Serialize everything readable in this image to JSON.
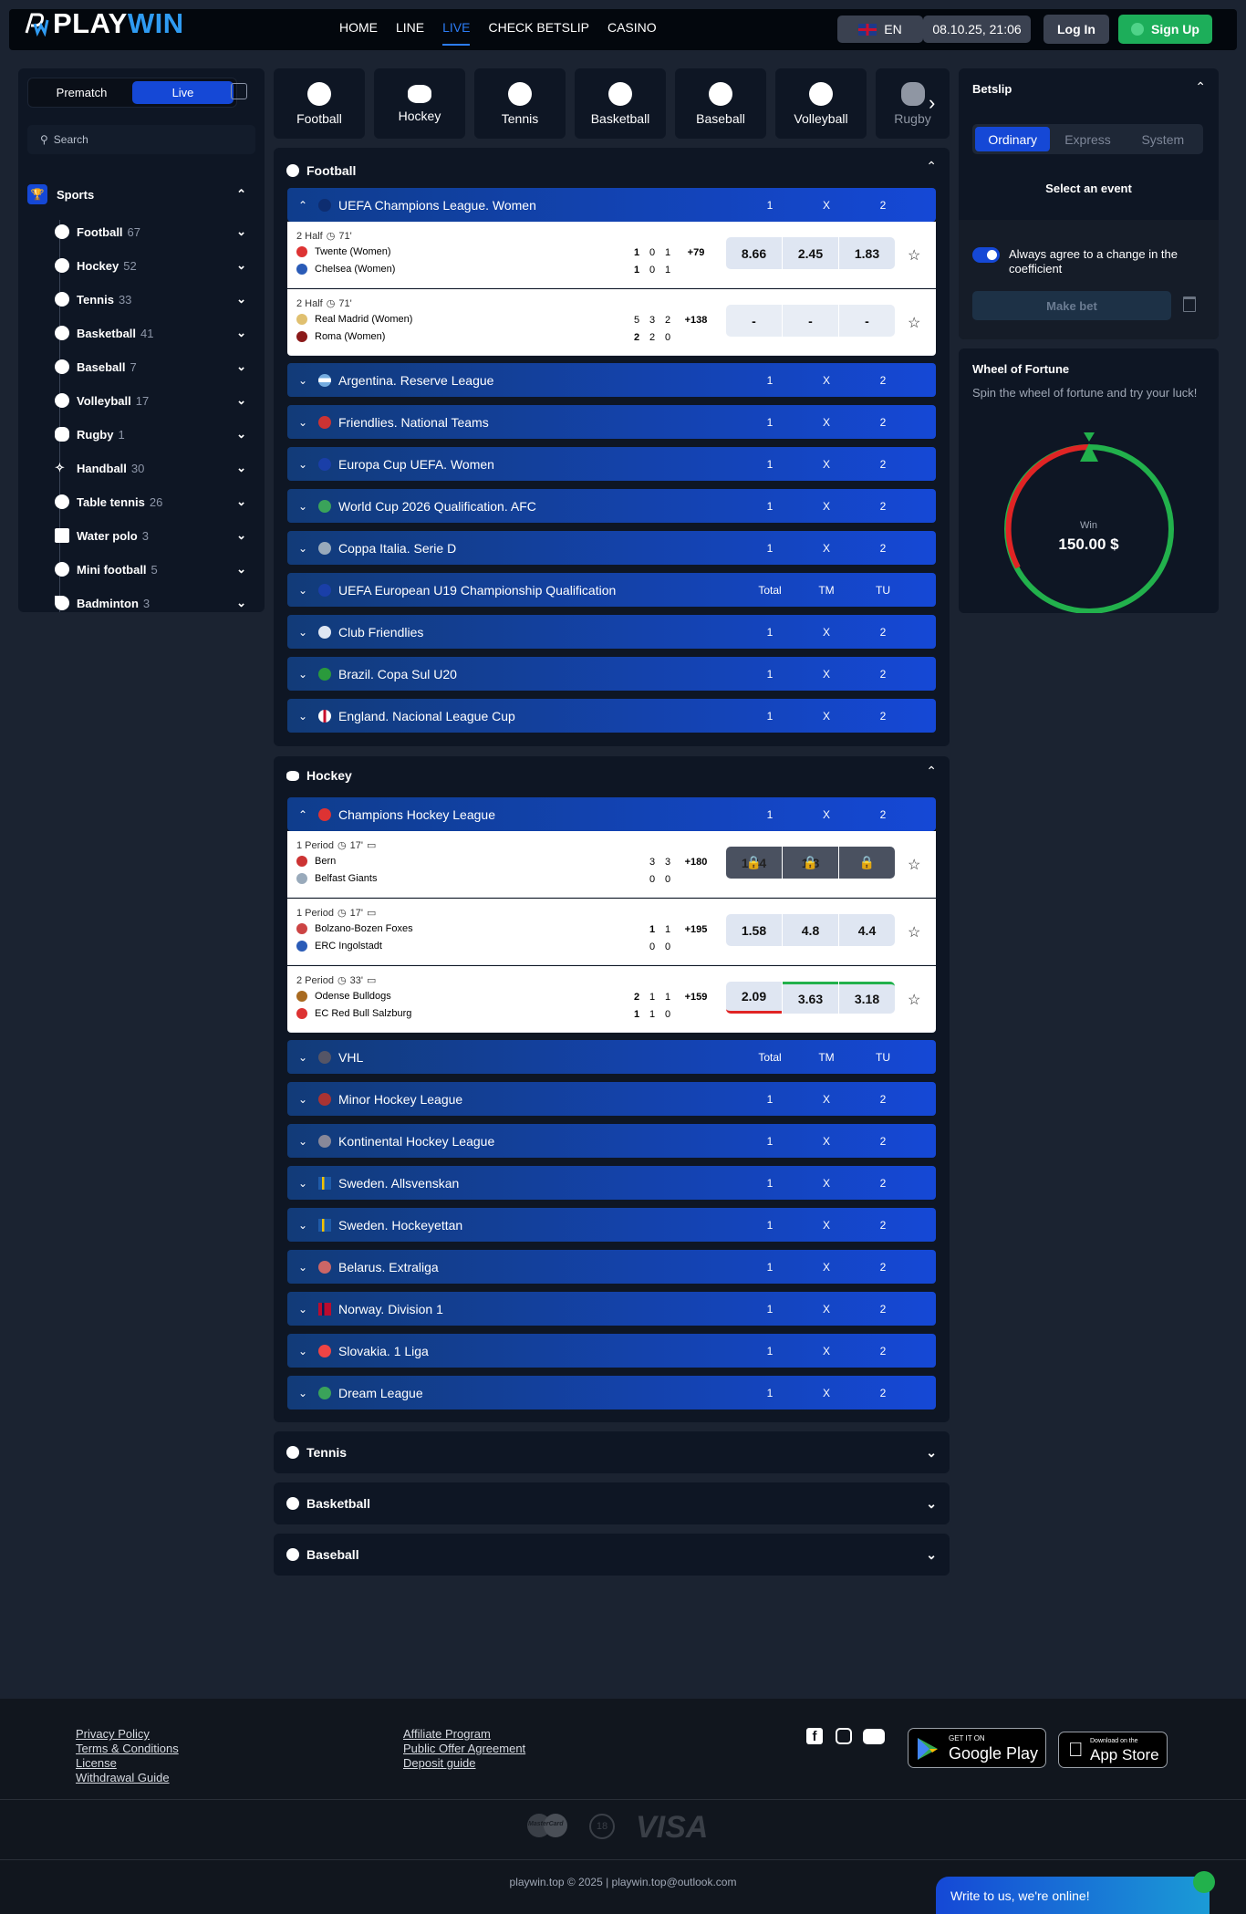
{
  "header": {
    "logo_play": "PLAY",
    "logo_win": "WIN",
    "nav": [
      "HOME",
      "LINE",
      "LIVE",
      "CHECK BETSLIP",
      "CASINO"
    ],
    "language": "EN",
    "datetime": "08.10.25, 21:06",
    "login": "Log In",
    "signup": "Sign Up"
  },
  "sidebar": {
    "tab_prematch": "Prematch",
    "tab_live": "Live",
    "search_placeholder": "Search",
    "sports_label": "Sports",
    "items": [
      {
        "name": "Football",
        "count": "67"
      },
      {
        "name": "Hockey",
        "count": "52"
      },
      {
        "name": "Tennis",
        "count": "33"
      },
      {
        "name": "Basketball",
        "count": "41"
      },
      {
        "name": "Baseball",
        "count": "7"
      },
      {
        "name": "Volleyball",
        "count": "17"
      },
      {
        "name": "Rugby",
        "count": "1"
      },
      {
        "name": "Handball",
        "count": "30"
      },
      {
        "name": "Table tennis",
        "count": "26"
      },
      {
        "name": "Water polo",
        "count": "3"
      },
      {
        "name": "Mini football",
        "count": "5"
      },
      {
        "name": "Badminton",
        "count": "3"
      }
    ]
  },
  "sport_tabs": [
    "Football",
    "Hockey",
    "Tennis",
    "Basketball",
    "Baseball",
    "Volleyball",
    "Rugby"
  ],
  "football": {
    "title": "Football",
    "leagues": [
      {
        "name": "UEFA Champions League. Women",
        "cols": [
          "1",
          "X",
          "2"
        ]
      },
      {
        "name": "Argentina. Reserve League",
        "cols": [
          "1",
          "X",
          "2"
        ]
      },
      {
        "name": "Friendlies. National Teams",
        "cols": [
          "1",
          "X",
          "2"
        ]
      },
      {
        "name": "Europa Cup UEFA. Women",
        "cols": [
          "1",
          "X",
          "2"
        ]
      },
      {
        "name": "World Cup 2026 Qualification. AFC",
        "cols": [
          "1",
          "X",
          "2"
        ]
      },
      {
        "name": "Coppa Italia. Serie D",
        "cols": [
          "1",
          "X",
          "2"
        ]
      },
      {
        "name": "UEFA European U19 Championship Qualification",
        "cols": [
          "Total",
          "TM",
          "TU"
        ]
      },
      {
        "name": "Club Friendlies",
        "cols": [
          "1",
          "X",
          "2"
        ]
      },
      {
        "name": "Brazil. Copa Sul U20",
        "cols": [
          "1",
          "X",
          "2"
        ]
      },
      {
        "name": "England. Nacional League Cup",
        "cols": [
          "1",
          "X",
          "2"
        ]
      }
    ],
    "matches": [
      {
        "period": "2 Half",
        "time": "71'",
        "team1": "Twente (Women)",
        "team2": "Chelsea (Women)",
        "s1": [
          "1",
          "0",
          "1"
        ],
        "s2": [
          "1",
          "0",
          "1"
        ],
        "more": "+79",
        "odds": [
          "8.66",
          "2.45",
          "1.83"
        ]
      },
      {
        "period": "2 Half",
        "time": "71'",
        "team1": "Real Madrid (Women)",
        "team2": "Roma (Women)",
        "s1": [
          "5",
          "3",
          "2"
        ],
        "s2": [
          "2",
          "2",
          "0"
        ],
        "more": "+138",
        "odds": [
          "-",
          "-",
          "-"
        ]
      }
    ]
  },
  "hockey": {
    "title": "Hockey",
    "leagues": [
      {
        "name": "Champions Hockey League",
        "cols": [
          "1",
          "X",
          "2"
        ]
      },
      {
        "name": "VHL",
        "cols": [
          "Total",
          "TM",
          "TU"
        ]
      },
      {
        "name": "Minor Hockey League",
        "cols": [
          "1",
          "X",
          "2"
        ]
      },
      {
        "name": "Kontinental Hockey League",
        "cols": [
          "1",
          "X",
          "2"
        ]
      },
      {
        "name": "Sweden. Allsvenskan",
        "cols": [
          "1",
          "X",
          "2"
        ]
      },
      {
        "name": "Sweden. Hockeyettan",
        "cols": [
          "1",
          "X",
          "2"
        ]
      },
      {
        "name": "Belarus. Extraliga",
        "cols": [
          "1",
          "X",
          "2"
        ]
      },
      {
        "name": "Norway. Division 1",
        "cols": [
          "1",
          "X",
          "2"
        ]
      },
      {
        "name": "Slovakia. 1 Liga",
        "cols": [
          "1",
          "X",
          "2"
        ]
      },
      {
        "name": "Dream League",
        "cols": [
          "1",
          "X",
          "2"
        ]
      }
    ],
    "matches": [
      {
        "period": "1 Period",
        "time": "17'",
        "team1": "Bern",
        "team2": "Belfast Giants",
        "s1": [
          "3",
          "3"
        ],
        "s2": [
          "0",
          "0"
        ],
        "more": "+180",
        "odds": [
          "1.44",
          "1.8",
          ""
        ]
      },
      {
        "period": "1 Period",
        "time": "17'",
        "team1": "Bolzano-Bozen Foxes",
        "team2": "ERC Ingolstadt",
        "s1": [
          "1",
          "1"
        ],
        "s2": [
          "0",
          "0"
        ],
        "more": "+195",
        "odds": [
          "1.58",
          "4.8",
          "4.4"
        ]
      },
      {
        "period": "2 Period",
        "time": "33'",
        "team1": "Odense Bulldogs",
        "team2": "EC Red Bull Salzburg",
        "s1": [
          "2",
          "1",
          "1"
        ],
        "s2": [
          "1",
          "1",
          "0"
        ],
        "more": "+159",
        "odds": [
          "2.09",
          "3.63",
          "3.18"
        ]
      }
    ]
  },
  "collapsed_sections": [
    "Tennis",
    "Basketball",
    "Baseball"
  ],
  "betslip": {
    "title": "Betslip",
    "tabs": [
      "Ordinary",
      "Express",
      "System"
    ],
    "empty": "Select an event",
    "agree": "Always agree to a change in the coefficient",
    "make_bet": "Make bet"
  },
  "wheel": {
    "title": "Wheel of Fortune",
    "subtitle": "Spin the wheel of fortune and try your luck!",
    "win_label": "Win",
    "amount": "150.00 $"
  },
  "footer": {
    "col1": [
      "Privacy Policy",
      "Terms & Conditions",
      "License",
      "Withdrawal Guide"
    ],
    "col2": [
      "Affiliate Program",
      "Public Offer Agreement",
      "Deposit guide"
    ],
    "google_small": "GET IT ON",
    "google_big": "Google Play",
    "apple_small": "Download on the",
    "apple_big": "App Store",
    "payments": [
      "MasterCard",
      "18",
      "VISA"
    ],
    "copyright": "playwin.top © 2025 | playwin.top@outlook.com",
    "chat": "Write to us, we're online!"
  },
  "colors": {
    "accent": "#1548d6",
    "brand_blue": "#2f9bf2",
    "signup": "#1dae5a",
    "panel": "#0e1624",
    "bg": "#1b2331"
  }
}
